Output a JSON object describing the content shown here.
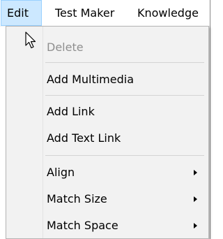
{
  "menubar": {
    "items": [
      {
        "label": "Edit",
        "active": true
      },
      {
        "label": "Test Maker",
        "active": false
      },
      {
        "label": "Knowledge",
        "active": false
      }
    ]
  },
  "edit_menu": {
    "items": [
      {
        "label": "Delete",
        "enabled": false,
        "submenu": false
      },
      {
        "label": "Add Multimedia",
        "enabled": true,
        "submenu": false
      },
      {
        "label": "Add Link",
        "enabled": true,
        "submenu": false
      },
      {
        "label": "Add Text Link",
        "enabled": true,
        "submenu": false
      },
      {
        "label": "Align",
        "enabled": true,
        "submenu": true
      },
      {
        "label": "Match Size",
        "enabled": true,
        "submenu": true
      },
      {
        "label": "Match Space",
        "enabled": true,
        "submenu": true
      }
    ]
  },
  "colors": {
    "active_menu_bg": "#cce8ff",
    "active_menu_border": "#99d1ff",
    "menu_bg": "#f2f2f2",
    "disabled_text": "#8f8f8f"
  },
  "icons": {
    "cursor": "mouse-pointer-icon",
    "submenu_arrow": "chevron-right-icon"
  }
}
